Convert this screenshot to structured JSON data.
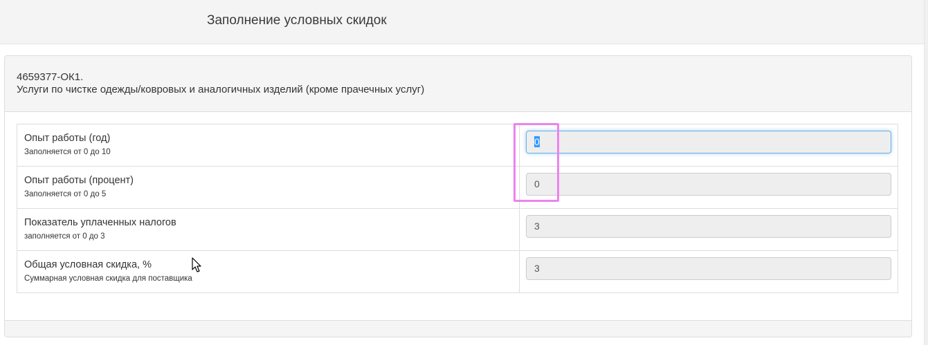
{
  "header": {
    "title": "Заполнение условных скидок"
  },
  "panel": {
    "code": "4659377-ОК1.",
    "description": "Услуги по чистке одежды/ковровых и аналогичных изделий (кроме прачечных услуг)"
  },
  "rows": [
    {
      "label": "Опыт работы (год)",
      "hint": "Заполняется от 0 до 10",
      "value": "0",
      "focused": true,
      "selected": true
    },
    {
      "label": "Опыт работы (процент)",
      "hint": "Заполняется от 0 до 5",
      "value": "0"
    },
    {
      "label": "Показатель уплаченных налогов",
      "hint": "заполняется от 0 до 3",
      "value": "3"
    },
    {
      "label": "Общая условная скидка, %",
      "hint": "Суммарная условная скидка для поставщика",
      "value": "3"
    }
  ],
  "colors": {
    "header_bg": "#f4f4f4",
    "input_bg": "#eeeeee",
    "focus_border": "#66afe9",
    "selection": "#3399ff",
    "highlight_annotation": "#ee82ee"
  }
}
